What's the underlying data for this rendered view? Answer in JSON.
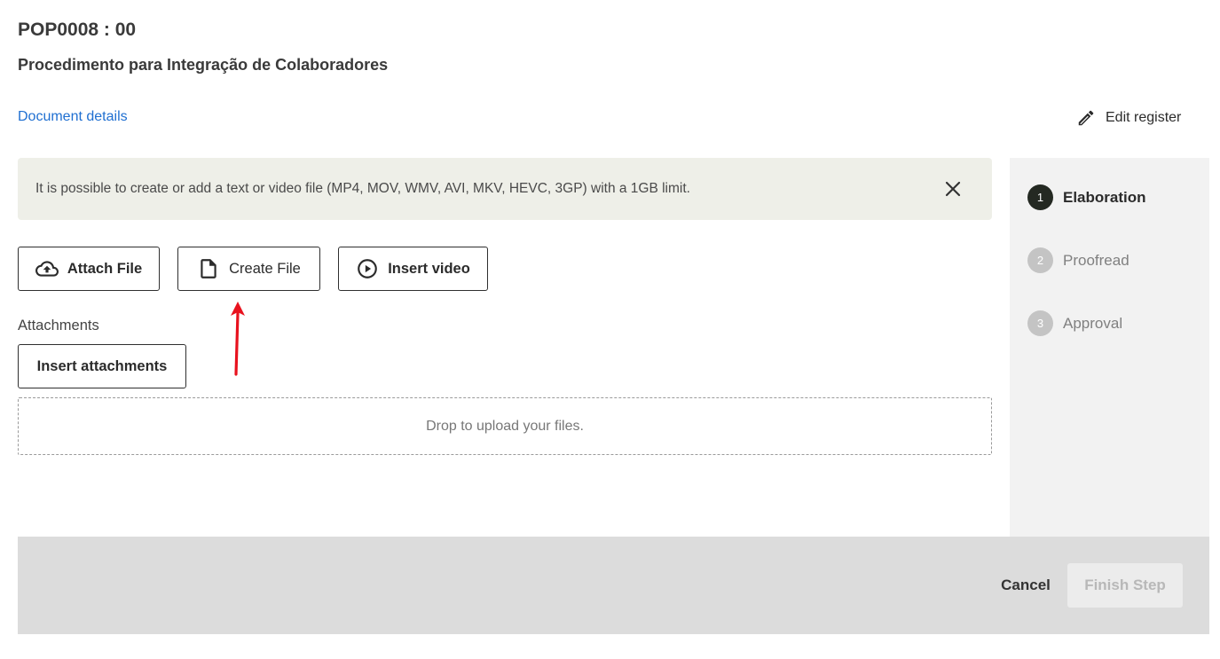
{
  "header": {
    "code": "POP0008 : 00",
    "title": "Procedimento para Integração de Colaboradores",
    "details_link": "Document details",
    "edit_label": "Edit register"
  },
  "banner": {
    "text": "It is possible to create or add a text or video file (MP4, MOV, WMV, AVI, MKV, HEVC, 3GP) with a 1GB limit."
  },
  "actions": {
    "attach_label": "Attach File",
    "create_label": "Create File",
    "video_label": "Insert video"
  },
  "attachments": {
    "label": "Attachments",
    "insert_label": "Insert attachments",
    "dropzone_text": "Drop to upload your files."
  },
  "steps": [
    {
      "number": "1",
      "label": "Elaboration",
      "state": "active"
    },
    {
      "number": "2",
      "label": "Proofread",
      "state": "inactive"
    },
    {
      "number": "3",
      "label": "Approval",
      "state": "inactive"
    }
  ],
  "footer": {
    "cancel_label": "Cancel",
    "finish_label": "Finish Step"
  },
  "colors": {
    "link": "#1f6fd1",
    "banner_bg": "#eeefe8",
    "active_step": "#242922",
    "annotation_arrow": "#e8121e"
  },
  "icons": {
    "edit": "pencil-icon",
    "close": "close-icon",
    "attach": "cloud-upload-icon",
    "create": "file-icon",
    "video": "play-circle-icon"
  }
}
